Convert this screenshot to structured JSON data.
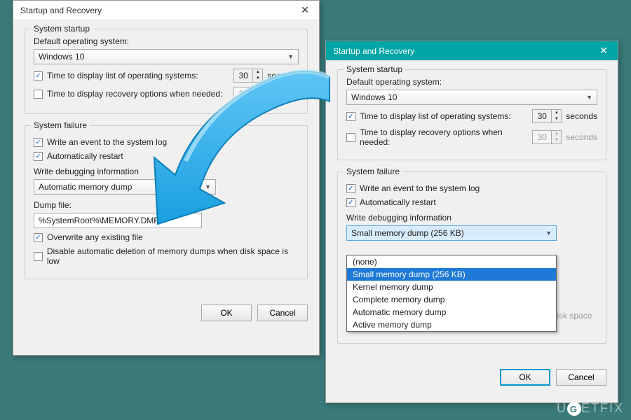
{
  "dialog1": {
    "title": "Startup and Recovery",
    "group_startup": "System startup",
    "label_default_os": "Default operating system:",
    "select_os": "Windows 10",
    "cb_time_list_label": "Time to display list of operating systems:",
    "cb_time_list_checked": true,
    "spinner_time_list": "30",
    "cb_time_recovery_label": "Time to display recovery options when needed:",
    "cb_time_recovery_checked": false,
    "spinner_time_recovery": "30",
    "seconds": "seconds",
    "group_failure": "System failure",
    "cb_event_log_label": "Write an event to the system log",
    "cb_event_log_checked": true,
    "cb_auto_restart_label": "Automatically restart",
    "cb_auto_restart_checked": true,
    "label_write_debug": "Write debugging information",
    "select_debug": "Automatic memory dump",
    "label_dump_file": "Dump file:",
    "input_dump_file": "%SystemRoot%\\MEMORY.DMP",
    "cb_overwrite_label": "Overwrite any existing file",
    "cb_overwrite_checked": true,
    "cb_disable_delete_label": "Disable automatic deletion of memory dumps when disk space is low",
    "cb_disable_delete_checked": false,
    "btn_ok": "OK",
    "btn_cancel": "Cancel"
  },
  "dialog2": {
    "title": "Startup and Recovery",
    "group_startup": "System startup",
    "label_default_os": "Default operating system:",
    "select_os": "Windows 10",
    "cb_time_list_label": "Time to display list of operating systems:",
    "cb_time_list_checked": true,
    "spinner_time_list": "30",
    "cb_time_recovery_label": "Time to display recovery options when needed:",
    "cb_time_recovery_checked": false,
    "spinner_time_recovery": "30",
    "seconds": "seconds",
    "group_failure": "System failure",
    "cb_event_log_label": "Write an event to the system log",
    "cb_event_log_checked": true,
    "cb_auto_restart_label": "Automatically restart",
    "cb_auto_restart_checked": true,
    "label_write_debug": "Write debugging information",
    "select_debug": "Small memory dump (256 KB)",
    "dropdown_options": [
      "(none)",
      "Small memory dump (256 KB)",
      "Kernel memory dump",
      "Complete memory dump",
      "Automatic memory dump",
      "Active memory dump"
    ],
    "dropdown_selected_index": 1,
    "cb_disable_delete_label": "Disable automatic deletion of memory dumps when disk space is low",
    "btn_ok": "OK",
    "btn_cancel": "Cancel"
  },
  "watermark": "UGETFIX"
}
